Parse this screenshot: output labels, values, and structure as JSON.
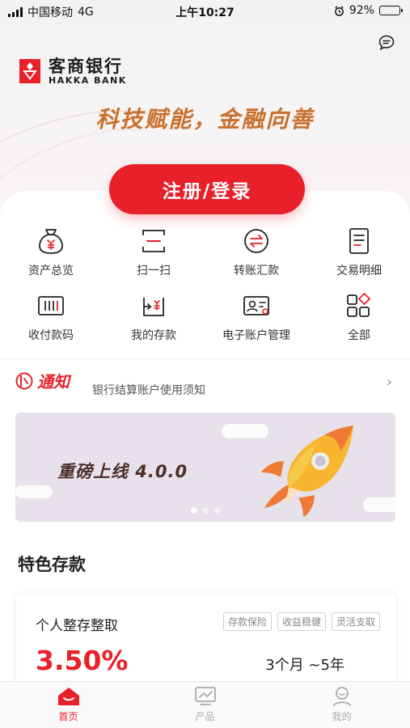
{
  "status_bar": {
    "carrier": "中国移动",
    "network": "4G",
    "time": "上午10:27",
    "battery": "92%",
    "battery_level": 0.92
  },
  "header": {
    "bank_name_cn": "客商银行",
    "bank_name_en": "HAKKA BANK",
    "slogan": "科技赋能，金融向善",
    "login_button": "注册/登录"
  },
  "quick_actions": [
    {
      "label": "资产总览",
      "icon": "asset-bag-icon"
    },
    {
      "label": "扫一扫",
      "icon": "scan-icon"
    },
    {
      "label": "转账汇款",
      "icon": "transfer-icon"
    },
    {
      "label": "交易明细",
      "icon": "transaction-list-icon"
    },
    {
      "label": "收付款码",
      "icon": "payment-code-icon"
    },
    {
      "label": "我的存款",
      "icon": "deposit-icon"
    },
    {
      "label": "电子账户管理",
      "icon": "account-card-icon"
    },
    {
      "label": "全部",
      "icon": "all-apps-icon"
    }
  ],
  "notice": {
    "title": "通知",
    "text": "银行结算账户使用须知"
  },
  "banner": {
    "text": "重磅上线 4.0.0",
    "page_count": 3,
    "active_page": 1
  },
  "featured": {
    "section_title": "特色存款",
    "product_name": "个人整存整取",
    "tags": [
      "存款保险",
      "收益稳健",
      "灵活支取"
    ],
    "rate": "3.50%",
    "term": "3个月 ~5年"
  },
  "tabbar": [
    {
      "label": "首页",
      "active": true
    },
    {
      "label": "产品",
      "active": false
    },
    {
      "label": "我的",
      "active": false
    }
  ],
  "colors": {
    "brand_red": "#e8202a",
    "slogan_gold": "#c9702c"
  }
}
